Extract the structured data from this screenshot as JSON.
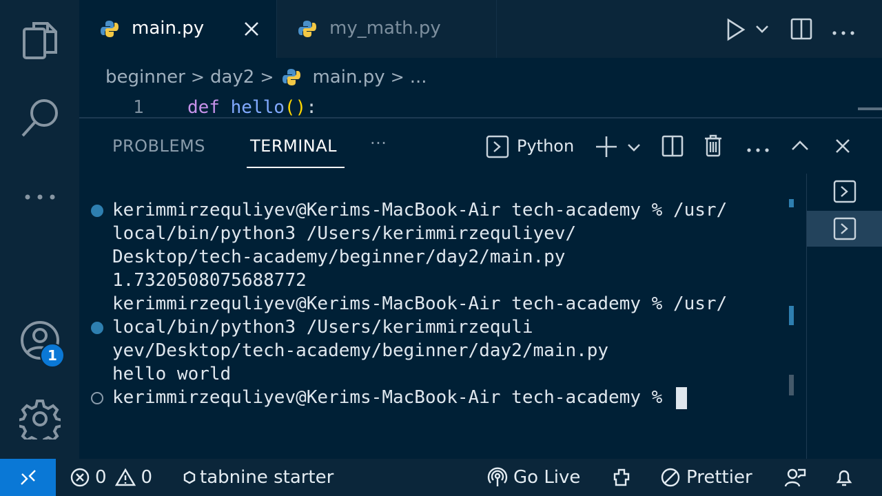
{
  "tabs": [
    {
      "label": "main.py",
      "active": true
    },
    {
      "label": "my_math.py",
      "active": false
    }
  ],
  "breadcrumb": [
    "beginner",
    "day2",
    "main.py",
    "..."
  ],
  "editor": {
    "line_number": "1",
    "code": {
      "keyword": "def",
      "function": "hello",
      "parens": "()",
      "colon": ":"
    }
  },
  "panel": {
    "tabs": {
      "problems": "PROBLEMS",
      "terminal": "TERMINAL",
      "more": "···"
    },
    "profile_label": "Python"
  },
  "terminal": {
    "lines": [
      "kerimmirzequliyev@Kerims-MacBook-Air tech-academy % /usr/",
      "local/bin/python3 /Users/kerimmirzequliyev/",
      "Desktop/tech-academy/beginner/day2/main.py",
      "1.7320508075688772",
      "kerimmirzequliyev@Kerims-MacBook-Air tech-academy % /usr/",
      "local/bin/python3 /Users/kerimmirzequli",
      "yev/Desktop/tech-academy/beginner/day2/main.py",
      "hello world",
      "kerimmirzequliyev@Kerims-MacBook-Air tech-academy % "
    ]
  },
  "activity": {
    "accounts_badge": "1"
  },
  "status": {
    "errors": "0",
    "warnings": "0",
    "tabnine": "tabnine starter",
    "go_live": "Go Live",
    "prettier": "Prettier"
  },
  "colors": {
    "accent": "#0a78d6",
    "background": "#002036",
    "sidebar": "#0b263a"
  }
}
